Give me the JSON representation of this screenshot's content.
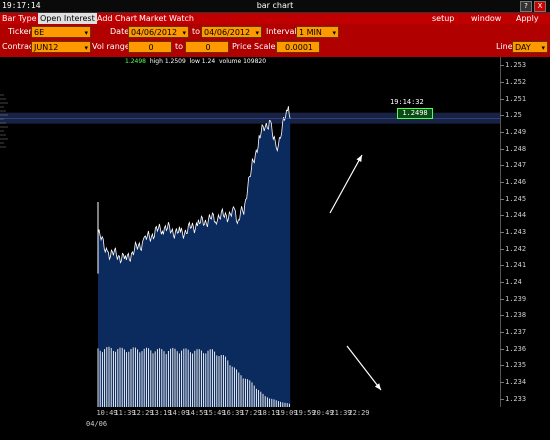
{
  "titlebar": {
    "clock": "19:17:14",
    "title": "bar chart",
    "help": "?",
    "close": "X"
  },
  "menubar": {
    "items": [
      "Bar Type",
      "Open Interest",
      "Add Chart",
      "Market Watch"
    ],
    "right": [
      "setup",
      "window",
      "Apply"
    ]
  },
  "controls": {
    "ticker_label": "Ticker",
    "ticker_value": "6E",
    "date_label": "Date",
    "date_from": "04/06/2012",
    "to_label": "to",
    "date_to": "04/06/2012",
    "interval_label": "Interval",
    "interval_value": "1 MIN",
    "contract_label": "Contract",
    "contract_value": "JUN12",
    "vol_range_label": "Vol range",
    "vol_from": "0",
    "vol_to_label": "to",
    "vol_to": "0",
    "price_scale_label": "Price Scale",
    "price_scale_value": "0.0001",
    "line_label": "Line",
    "line_value": "DAY"
  },
  "info": {
    "last": "1.2498",
    "high": "high 1.2509",
    "low": "low 1.24",
    "volume": "volume 109820"
  },
  "cursor": {
    "time": "19:14:32",
    "price": "1.2498"
  },
  "date_label": "04/06",
  "colors": {
    "menu_bg": "#c00000",
    "field_bg": "#ff9900",
    "area_fill": "#0b2a5e",
    "price_line": "#ffffff"
  },
  "chart_data": {
    "type": "area",
    "y_axis": [
      "1.253",
      "1.252",
      "1.251",
      "1.25",
      "1.249",
      "1.248",
      "1.247",
      "1.246",
      "1.245",
      "1.244",
      "1.243",
      "1.242",
      "1.241",
      "1.24",
      "1.239",
      "1.238",
      "1.237",
      "1.236",
      "1.235",
      "1.234",
      "1.233"
    ],
    "x_axis": [
      "10:49",
      "11:39",
      "12:29",
      "13:19",
      "14:09",
      "14:59",
      "15:49",
      "16:39",
      "17:29",
      "18:19",
      "19:09",
      "19:59",
      "20:49",
      "21:39",
      "22:29"
    ],
    "ylim": [
      1.2325,
      1.2535
    ],
    "series": [
      {
        "x": [
          "10:20",
          "10:49",
          "11:39",
          "12:29",
          "13:19",
          "14:09",
          "14:59",
          "15:49",
          "16:39",
          "16:50",
          "17:05",
          "17:29",
          "17:50",
          "18:19",
          "18:35",
          "18:50",
          "19:09",
          "19:14"
        ],
        "values": [
          1.2429,
          1.2418,
          1.2414,
          1.2425,
          1.2433,
          1.2429,
          1.2435,
          1.2439,
          1.2441,
          1.2437,
          1.2444,
          1.247,
          1.2488,
          1.2498,
          1.2478,
          1.2491,
          1.2505,
          1.2498
        ]
      }
    ],
    "volume": [
      95,
      96,
      94,
      95,
      94,
      93,
      94,
      93,
      92,
      92,
      80,
      55,
      40,
      18,
      10,
      5
    ]
  }
}
